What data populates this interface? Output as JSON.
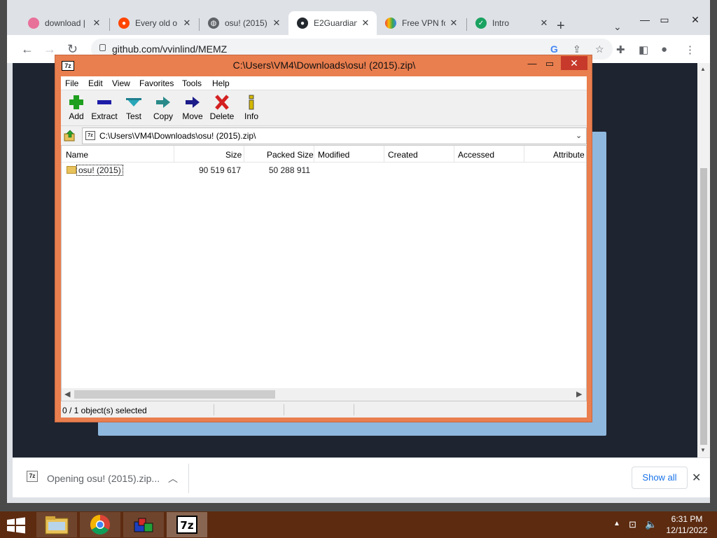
{
  "browser": {
    "tabs": [
      {
        "title": "download |",
        "favicon": "pink-circle-icon",
        "color": "#e8719a"
      },
      {
        "title": "Every old o",
        "favicon": "reddit-icon",
        "color": "#ff4500"
      },
      {
        "title": "osu! (2015)",
        "favicon": "globe-icon",
        "color": "#5f6368"
      },
      {
        "title": "E2Guardian",
        "favicon": "github-icon",
        "color": "#24292f",
        "active": true
      },
      {
        "title": "Free VPN fo",
        "favicon": "rainbow-icon",
        "color": "#34a853"
      },
      {
        "title": "Intro",
        "favicon": "shield-icon",
        "color": "#1aa260"
      }
    ],
    "new_tab_label": "+",
    "url": "github.com/vvinlind/MEMZ"
  },
  "download_bar": {
    "file_text": "Opening osu! (2015).zip...",
    "show_all_label": "Show all"
  },
  "zip": {
    "window_title": "C:\\Users\\VM4\\Downloads\\osu! (2015).zip\\",
    "menu": [
      "File",
      "Edit",
      "View",
      "Favorites",
      "Tools",
      "Help"
    ],
    "toolbar": [
      {
        "label": "Add",
        "icon": "plus-icon",
        "color": "#1f9f1f"
      },
      {
        "label": "Extract",
        "icon": "minus-icon",
        "color": "#1c1ca8"
      },
      {
        "label": "Test",
        "icon": "check-icon",
        "color": "#29a7b8"
      },
      {
        "label": "Copy",
        "icon": "copy-arrow-icon",
        "color": "#2a8a8a"
      },
      {
        "label": "Move",
        "icon": "move-arrow-icon",
        "color": "#1c1c8a"
      },
      {
        "label": "Delete",
        "icon": "delete-x-icon",
        "color": "#d42020"
      },
      {
        "label": "Info",
        "icon": "info-icon",
        "color": "#d4b800"
      }
    ],
    "address": "C:\\Users\\VM4\\Downloads\\osu! (2015).zip\\",
    "columns": [
      "Name",
      "Size",
      "Packed Size",
      "Modified",
      "Created",
      "Accessed",
      "Attribute"
    ],
    "rows": [
      {
        "name": "osu! (2015)",
        "size": "90 519 617",
        "packed_size": "50 288 911"
      }
    ],
    "status": "0 / 1 object(s) selected"
  },
  "taskbar": {
    "time": "6:31 PM",
    "date": "12/11/2022",
    "icon_label": "7z"
  },
  "colors": {
    "zip_frame": "#e97e4e",
    "taskbar": "#5c2b10",
    "page_bg": "#1e2430",
    "accent_blue": "#1a73e8"
  }
}
